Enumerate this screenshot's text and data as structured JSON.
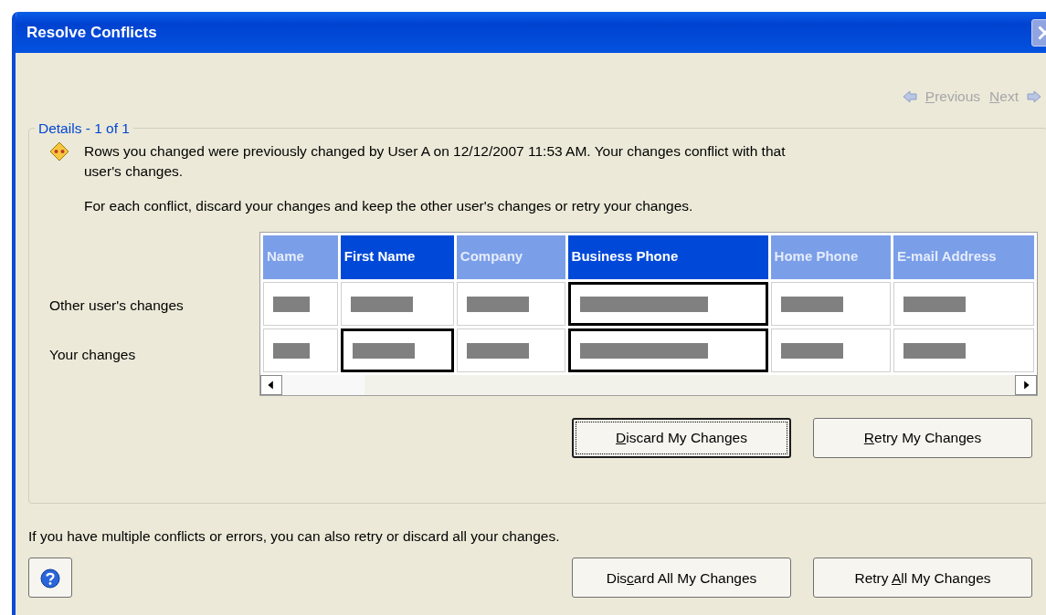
{
  "window": {
    "title": "Resolve Conflicts"
  },
  "nav": [
    {
      "kind": "previous",
      "label": {
        "key": "P",
        "post": "revious"
      },
      "disabled": true
    },
    {
      "kind": "next",
      "label": {
        "key": "N",
        "post": "ext"
      },
      "disabled": true
    }
  ],
  "details": {
    "title": "Details - 1 of 1",
    "message": "Rows you changed were previously changed by User A on 12/12/2007 11:53 AM. Your changes conflict with that user's changes.",
    "instruction": "For each conflict, discard your changes and keep the other user's changes or retry your changes.",
    "table": {
      "columns": [
        {
          "label": "Name",
          "selected": false
        },
        {
          "label": "First Name",
          "selected": true
        },
        {
          "label": "Company",
          "selected": false
        },
        {
          "label": "Business Phone",
          "selected": true
        },
        {
          "label": "Home Phone",
          "selected": false
        },
        {
          "label": "E-mail Address",
          "selected": false
        }
      ],
      "rows": [
        {
          "label": "Other user's changes",
          "conflicts": [
            false,
            false,
            false,
            true,
            false,
            false
          ]
        },
        {
          "label": "Your changes",
          "conflicts": [
            false,
            true,
            false,
            true,
            false,
            false
          ]
        }
      ]
    },
    "buttons": [
      {
        "label": {
          "key": "D",
          "post": "iscard My Changes"
        },
        "focused": true
      },
      {
        "label": {
          "key": "R",
          "post": "etry My Changes"
        },
        "focused": false
      }
    ]
  },
  "footer": {
    "text": "If you have multiple conflicts or errors, you can also retry or discard all your changes.",
    "buttons": [
      {
        "label": {
          "pre": "Dis",
          "key": "c",
          "post": "ard All My Changes"
        },
        "focused": false
      },
      {
        "label": {
          "pre": "Retry ",
          "key": "A",
          "post": "ll My Changes"
        },
        "focused": false
      }
    ]
  }
}
